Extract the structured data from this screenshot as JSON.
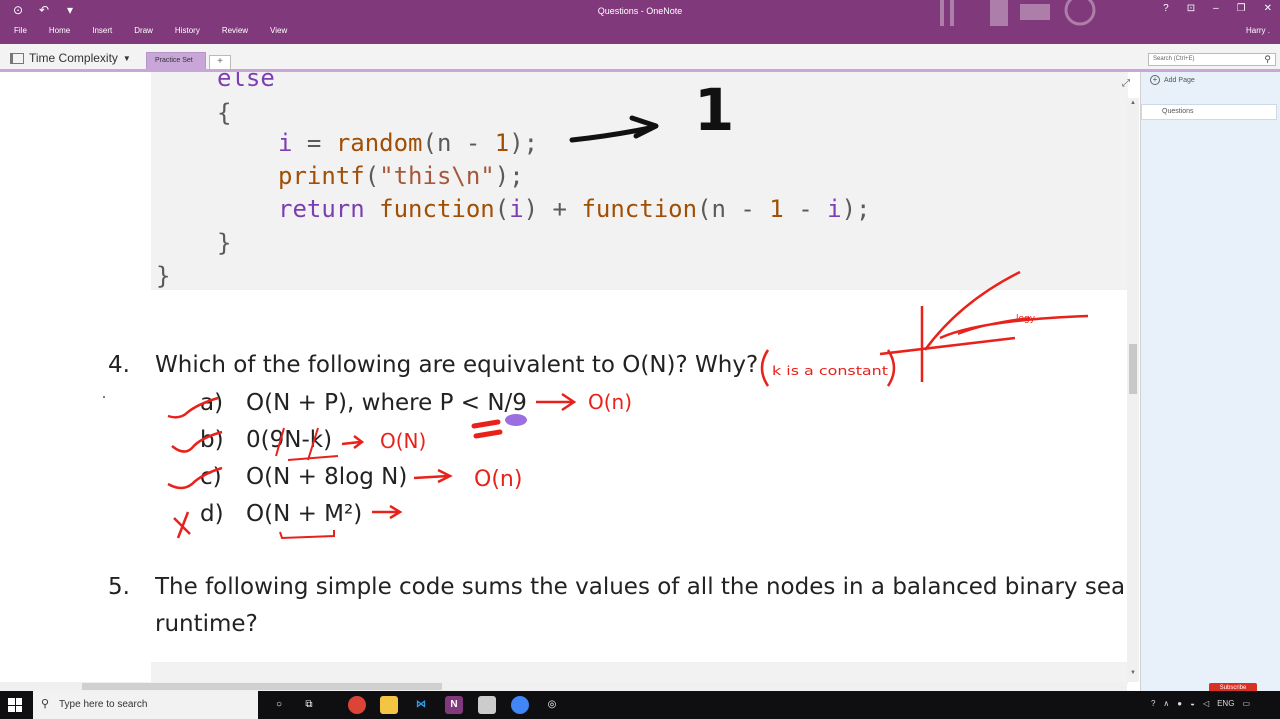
{
  "window": {
    "title": "Questions - OneNote",
    "user": "Harry .",
    "menus": [
      "File",
      "Home",
      "Insert",
      "Draw",
      "History",
      "Review",
      "View"
    ]
  },
  "notebook": {
    "name": "Time Complexity",
    "tab": "Practice Set",
    "tab_add": "+",
    "search_placeholder": "Search (Ctrl+E)"
  },
  "pages_panel": {
    "add_page": "Add Page",
    "pages": [
      "Questions"
    ]
  },
  "code": {
    "line1": "else",
    "line2": "{",
    "line3_a": "i",
    "line3_b": " = ",
    "line3_c": "random",
    "line3_d": "(n - ",
    "line3_e": "1",
    "line3_f": ");",
    "line4_a": "printf",
    "line4_b": "(",
    "line4_c": "\"this\\n\"",
    "line4_d": ");",
    "line5_a": "return",
    "line5_b": " function",
    "line5_c": "(",
    "line5_d": "i",
    "line5_e": ") + ",
    "line5_f": "function",
    "line5_g": "(n - ",
    "line5_h": "1",
    "line5_i": " - ",
    "line5_j": "i",
    "line5_k": ");",
    "line6": "}",
    "line7": "}"
  },
  "question4": {
    "number": "4.",
    "text": "Which of the following are equivalent to O(N)? Why?",
    "options": [
      {
        "letter": "a)",
        "text": "O(N + P), where P < N/9"
      },
      {
        "letter": "b)",
        "text": "0(9N-k)"
      },
      {
        "letter": "c)",
        "text": "O(N + 8log N)"
      },
      {
        "letter": "d)",
        "text": "O(N + M²)"
      }
    ]
  },
  "question5": {
    "number": "5.",
    "line1": "The following simple code sums the values of all the nodes in a balanced binary searcl",
    "line2": "runtime?"
  },
  "annotations": {
    "one": "1",
    "k_constant": "k is a constant",
    "o_n_a": "O(n)",
    "o_n_b": "O(N)",
    "o_n_c": "O(n)",
    "logy": "logy"
  },
  "taskbar": {
    "search_placeholder": "Type here to search",
    "lang": "ENG",
    "subscribe": "Subscribe"
  },
  "colors": {
    "ribbon": "#80397b",
    "tab_active": "#c8a6d8",
    "ink_red": "#e8221b",
    "ink_black": "#111111",
    "ink_purple": "#9b6fe0"
  }
}
